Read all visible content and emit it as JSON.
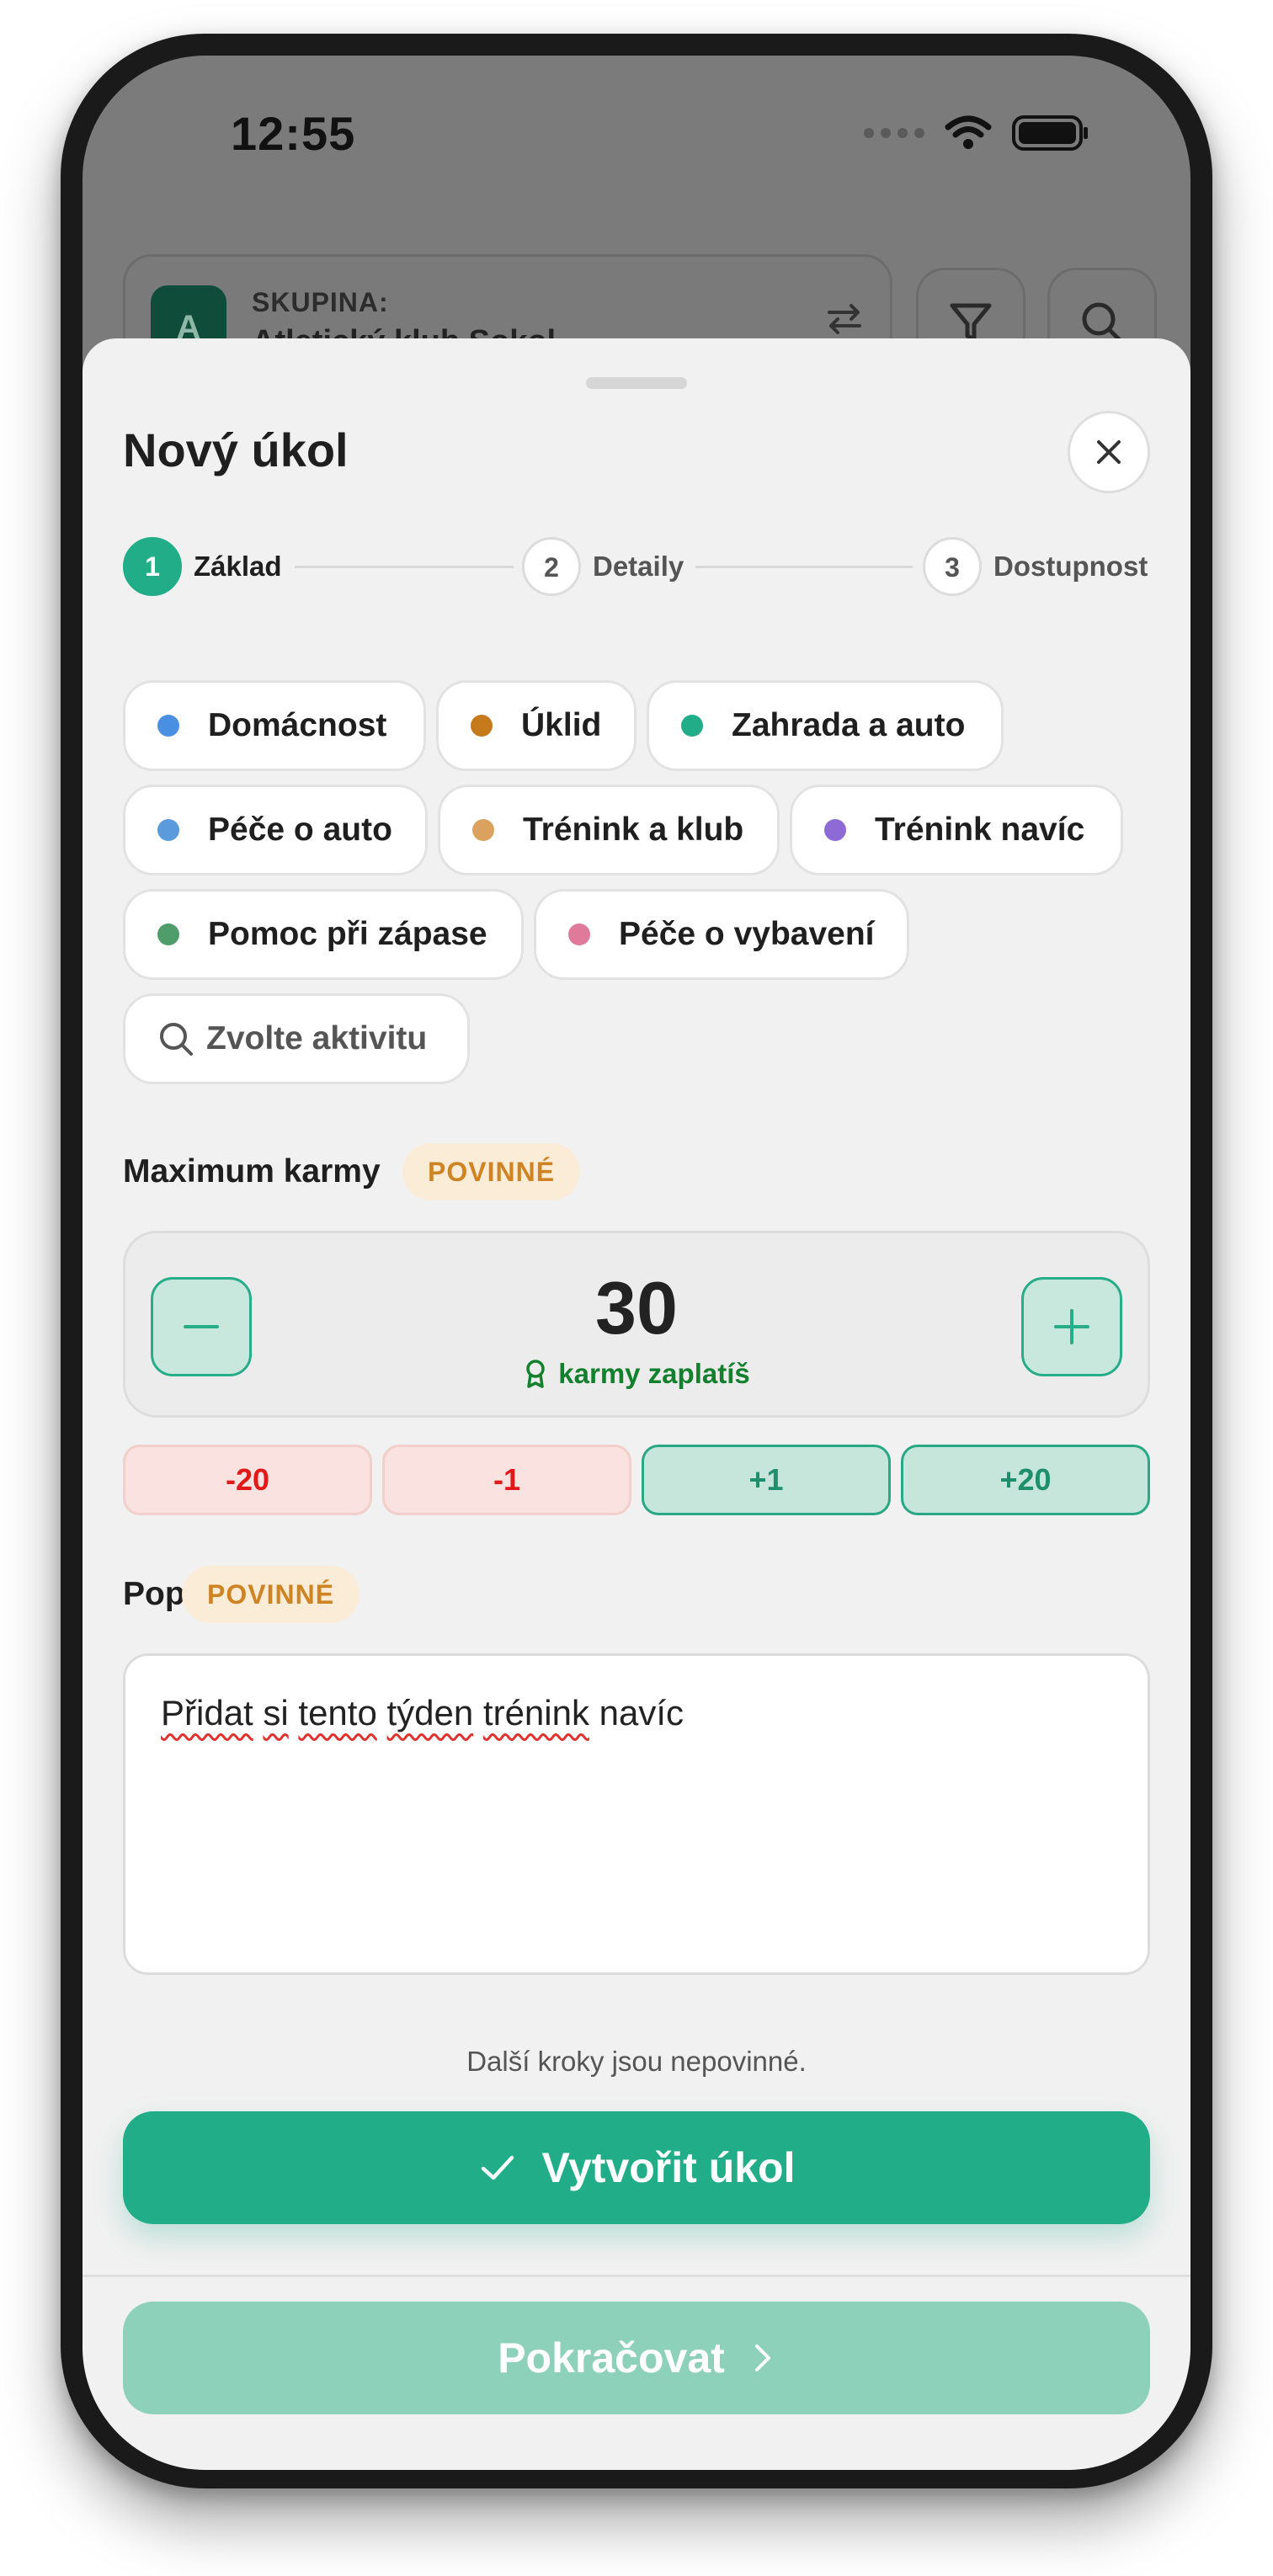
{
  "status_bar": {
    "time": "12:55"
  },
  "background": {
    "group_label": "SKUPINA:",
    "group_name": "Atletický klub Sokol",
    "avatar_letter": "A"
  },
  "sheet": {
    "title": "Nový úkol",
    "steps": [
      {
        "number": "1",
        "label": "Základ",
        "active": true
      },
      {
        "number": "2",
        "label": "Detaily",
        "active": false
      },
      {
        "number": "3",
        "label": "Dostupnost",
        "active": false
      }
    ],
    "categories": [
      {
        "label": "Domácnost",
        "color": "#4a90e2"
      },
      {
        "label": "Úklid",
        "color": "#c77a1c"
      },
      {
        "label": "Zahrada a auto",
        "color": "#21ad88"
      },
      {
        "label": "Péče o auto",
        "color": "#5b9bdc"
      },
      {
        "label": "Trénink a klub",
        "color": "#dba25f"
      },
      {
        "label": "Trénink navíc",
        "color": "#8e6ad6"
      },
      {
        "label": "Pomoc při zápase",
        "color": "#4f9d6a"
      },
      {
        "label": "Péče o vybavení",
        "color": "#e07a9b"
      }
    ],
    "activity_search": {
      "placeholder": "Zvolte aktivitu"
    },
    "karma": {
      "label": "Maximum karmy",
      "badge": "POVINNÉ",
      "value": "30",
      "caption": "karmy zaplatíš",
      "quick_adjust": [
        "-20",
        "-1",
        "+1",
        "+20"
      ]
    },
    "description": {
      "label": "Popis",
      "badge": "POVINNÉ",
      "value_words": [
        "Přidat",
        "si",
        "tento",
        "týden",
        "trénink",
        "navíc"
      ]
    },
    "hint": "Další kroky jsou nepovinné.",
    "create_button": "Vytvořit úkol",
    "continue_button": "Pokračovat"
  },
  "colors": {
    "accent": "#21ad88",
    "accent_light": "#8ed1bb",
    "required_badge": "#cf8424",
    "negative": "#e11919",
    "karma_caption": "#13802d"
  }
}
